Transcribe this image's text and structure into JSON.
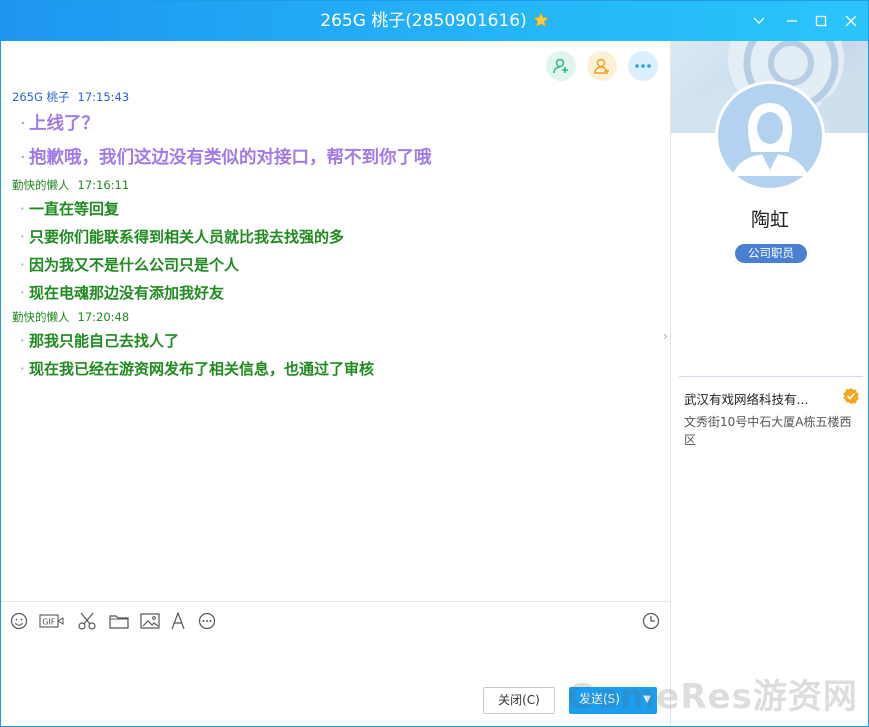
{
  "window": {
    "title": "265G 桃子(2850901616)",
    "badge_icon": "vip-star-icon",
    "controls": [
      "chevron-down-icon",
      "minimize-icon",
      "maximize-icon",
      "close-icon"
    ]
  },
  "chat": {
    "top_actions": [
      {
        "name": "add-friend-icon",
        "color": "#2bb98a"
      },
      {
        "name": "contact-card-icon",
        "color": "#f0a020"
      },
      {
        "name": "more-icon",
        "color": "#2a9df0"
      }
    ],
    "blocks": [
      {
        "sender": "265G 桃子",
        "time": "17:15:43",
        "sender_color": "#2a62d4",
        "style": "purple",
        "lines": [
          "上线了？",
          "抱歉哦，我们这边没有类似的对接口，帮不到你了哦"
        ]
      },
      {
        "sender": "勤快的懒人",
        "time": "17:16:11",
        "sender_color": "#1f8a1f",
        "style": "green",
        "lines": [
          "一直在等回复",
          "只要你们能联系得到相关人员就比我去找强的多",
          "因为我又不是什么公司只是个人",
          "现在电魂那边没有添加我好友"
        ]
      },
      {
        "sender": "勤快的懒人",
        "time": "17:20:48",
        "sender_color": "#1f8a1f",
        "style": "green",
        "lines": [
          "那我只能自己去找人了",
          "现在我已经在游资网发布了相关信息，也通过了审核"
        ]
      }
    ]
  },
  "toolbar": {
    "tools": [
      "emoji-icon",
      "gif-icon",
      "scissors-icon",
      "folder-icon",
      "image-icon",
      "font-icon",
      "more-circle-icon"
    ],
    "history_icon": "clock-icon"
  },
  "buttons": {
    "close_label": "关闭(C)",
    "send_label": "发送(S)"
  },
  "profile": {
    "name": "陶虹",
    "tag": "公司职员",
    "company": "武汉有戏网络科技有...",
    "address": "文秀街10号中石大厦A栋五楼西区",
    "verified_icon": "verified-badge-icon"
  },
  "watermark": "GameRes游资网"
}
